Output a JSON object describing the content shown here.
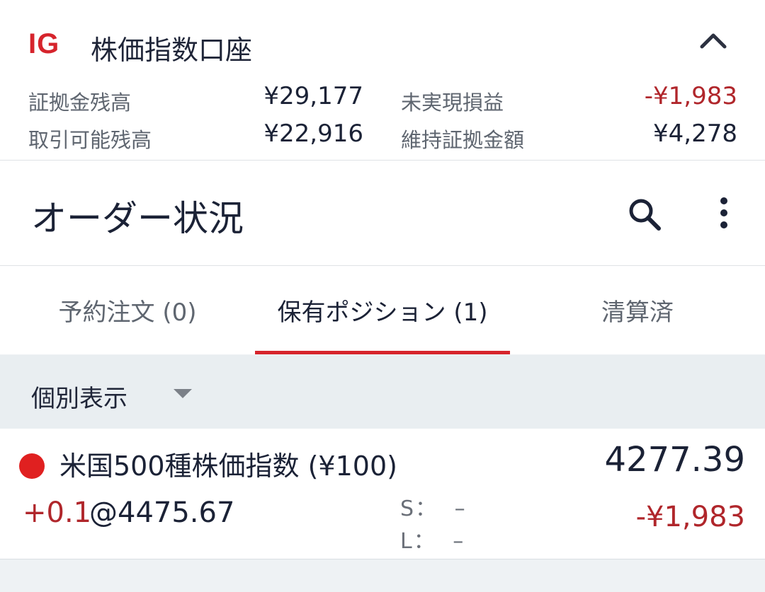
{
  "account": {
    "logo": "IG",
    "title": "株価指数口座",
    "rows": [
      {
        "label": "証拠金残高",
        "value": "¥29,177",
        "label2": "未実現損益",
        "value2": "-¥1,983"
      },
      {
        "label": "取引可能残高",
        "value": "¥22,916",
        "label2": "維持証拠金額",
        "value2": "¥4,278"
      }
    ],
    "collapse_icon": "chevron-up-icon"
  },
  "header": {
    "title": "オーダー状況",
    "search_icon": "search-icon",
    "more_icon": "more-vertical-icon"
  },
  "tabs": [
    {
      "label": "予約注文 (0)"
    },
    {
      "label": "保有ポジション (1)",
      "active": true
    },
    {
      "label": "清算済"
    }
  ],
  "filter": {
    "label": "個別表示"
  },
  "position": {
    "name": "米国500種株価指数 (¥100)",
    "price": "4277.39",
    "qty": "+0.1",
    "at": "@4475.67",
    "stop_label": "S：",
    "stop_value": "–",
    "limit_label": "L：",
    "limit_value": "–",
    "pl": "-¥1,983",
    "direction_color": "#e02020"
  },
  "colors": {
    "accent": "#d6242c",
    "negative": "#b0262b",
    "text": "#1b2236"
  }
}
